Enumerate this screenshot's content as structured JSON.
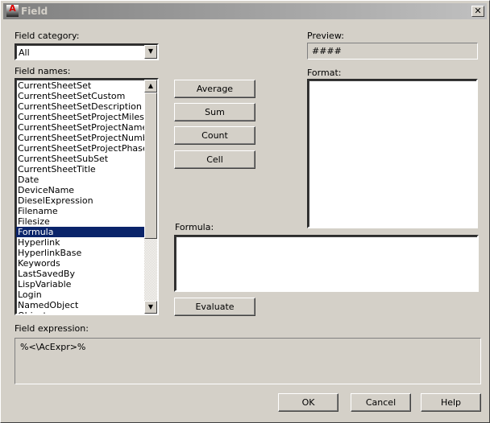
{
  "window": {
    "title": "Field",
    "close": "✕"
  },
  "category": {
    "label": "Field category:",
    "value": "All"
  },
  "names": {
    "label": "Field names:",
    "items": [
      "CurrentSheetSet",
      "CurrentSheetSetCustom",
      "CurrentSheetSetDescription",
      "CurrentSheetSetProjectMilestone",
      "CurrentSheetSetProjectName",
      "CurrentSheetSetProjectNumber",
      "CurrentSheetSetProjectPhase",
      "CurrentSheetSubSet",
      "CurrentSheetTitle",
      "Date",
      "DeviceName",
      "DieselExpression",
      "Filename",
      "Filesize",
      "Formula",
      "Hyperlink",
      "HyperlinkBase",
      "Keywords",
      "LastSavedBy",
      "LispVariable",
      "Login",
      "NamedObject",
      "Object"
    ],
    "selected": "Formula"
  },
  "buttons": {
    "average": "Average",
    "sum": "Sum",
    "count": "Count",
    "cell": "Cell",
    "evaluate": "Evaluate",
    "ok": "OK",
    "cancel": "Cancel",
    "help": "Help"
  },
  "preview": {
    "label": "Preview:",
    "value": "####"
  },
  "format": {
    "label": "Format:"
  },
  "formula": {
    "label": "Formula:",
    "value": ""
  },
  "expression": {
    "label": "Field expression:",
    "value": "%<\\AcExpr>%"
  }
}
